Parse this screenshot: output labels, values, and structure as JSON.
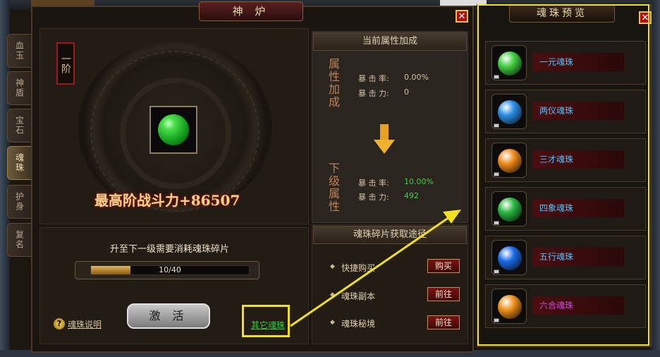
{
  "main_title": "神 炉",
  "side_tabs": [
    "血玉",
    "神盾",
    "宝石",
    "魂珠",
    "护身",
    "复名"
  ],
  "active_tab_index": 3,
  "tier_badge": "一阶",
  "power_text": "最高阶战斗力+86507",
  "current": {
    "section_title": "当前属性加成",
    "vlabel": "属性加成",
    "crit_rate_label": "暴 击 率:",
    "crit_rate_value": "0.00%",
    "crit_power_label": "暴 击 力:",
    "crit_power_value": "0"
  },
  "next": {
    "vlabel": "下级属性",
    "crit_rate_label": "暴 击 率:",
    "crit_rate_value": "10.00%",
    "crit_power_label": "暴 击 力:",
    "crit_power_value": "492"
  },
  "upgrade": {
    "text": "升至下一级需要消耗魂珠碎片",
    "progress_text": "10/40",
    "progress_fraction": 0.25
  },
  "activate_label": "激 活",
  "help_link": "魂珠说明",
  "other_link": "其它魂珠",
  "sources": {
    "title": "魂珠碎片获取途径",
    "items": [
      {
        "label": "快捷购买",
        "button": "购买"
      },
      {
        "label": "魂珠副本",
        "button": "前往"
      },
      {
        "label": "魂珠秘境",
        "button": "前往"
      }
    ]
  },
  "preview": {
    "title": "魂珠预览",
    "orbs": [
      {
        "name": "一元魂珠",
        "color": "#40d040",
        "name_color": "#4ec0ff"
      },
      {
        "name": "两仪魂珠",
        "color": "#2a8ee8",
        "name_color": "#4ec0ff"
      },
      {
        "name": "三才魂珠",
        "color": "#f08a1a",
        "name_color": "#4ec0ff"
      },
      {
        "name": "四象魂珠",
        "color": "#28b840",
        "name_color": "#4ec0ff"
      },
      {
        "name": "五行魂珠",
        "color": "#1a6ae8",
        "name_color": "#4ec0ff"
      },
      {
        "name": "六合魂珠",
        "color": "#f0901a",
        "name_color": "#d048e0"
      }
    ]
  },
  "colors": {
    "highlight_yellow": "#f0e020",
    "green_stat": "#3cd43c",
    "button_red": "#7a1212"
  }
}
